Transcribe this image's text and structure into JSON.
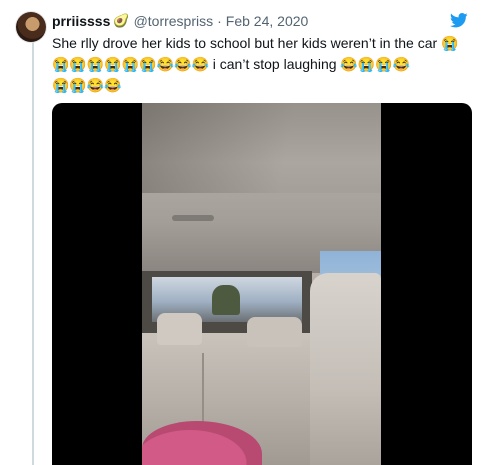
{
  "tweet": {
    "display_name": "prriissss",
    "name_emoji": "🥑",
    "handle": "@torrespriss",
    "separator": "·",
    "date": "Feb 24, 2020",
    "line1": "She rlly drove her kids to school but her kids weren’t in the car 😭",
    "line2": "😭😭😭😭😭😭😂😂😂 i can’t stop laughing 😂😭😭😂",
    "line3": "😭😭😂😂"
  },
  "icons": {
    "brand": "twitter-bird-icon",
    "avatar": "avatar"
  },
  "colors": {
    "twitter_blue": "#1d9bf0",
    "text_primary": "#0f1419",
    "text_secondary": "#536471",
    "thread_line": "#cfd9de",
    "media_background": "#000000"
  }
}
